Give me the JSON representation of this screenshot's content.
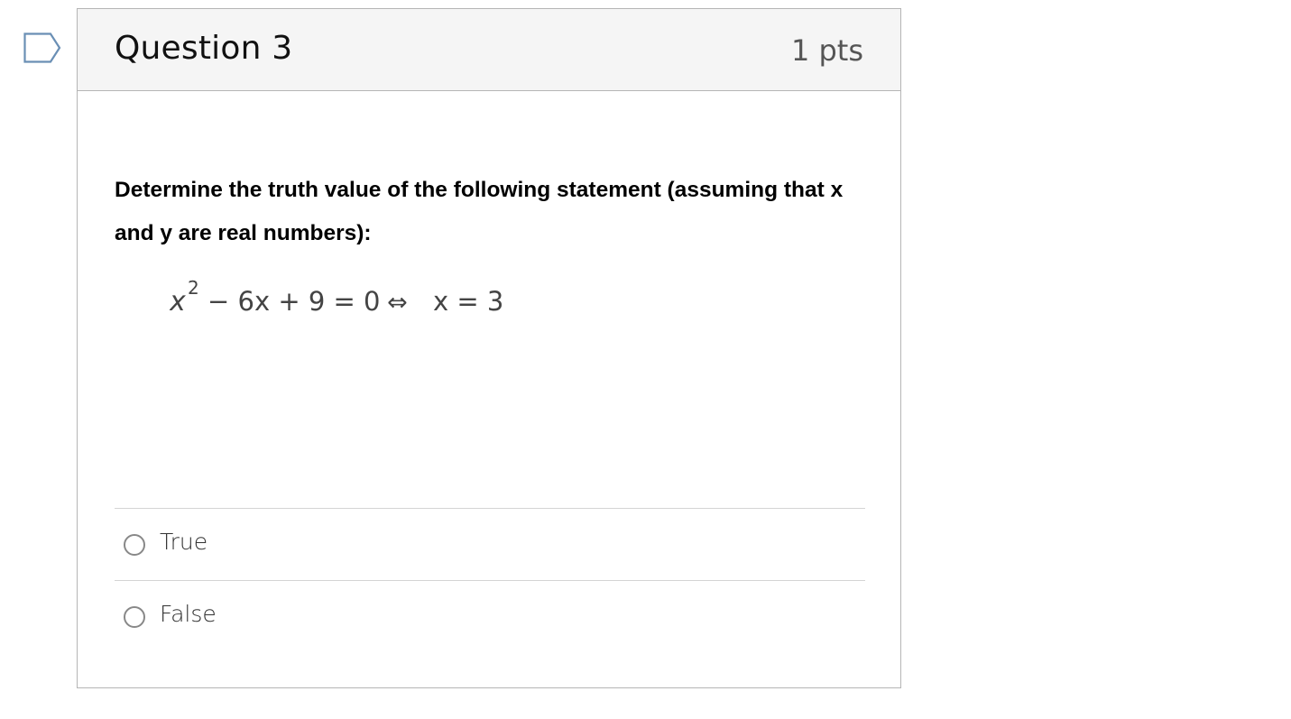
{
  "question": {
    "title": "Question 3",
    "points": "1 pts",
    "prompt": "Determine the truth value of the following statement (assuming that x and y are real numbers):",
    "equation": {
      "lhs_base": "x",
      "lhs_exp": "2",
      "lhs_rest": "− 6x + 9 = 0",
      "connective": "⇔",
      "rhs": "x = 3"
    }
  },
  "answers": [
    {
      "label": "True",
      "selected": false
    },
    {
      "label": "False",
      "selected": false
    }
  ],
  "icons": {
    "flag": "bookmark-flag-icon"
  },
  "colors": {
    "header_bg": "#f5f5f5",
    "border": "#b5b5b5",
    "flag_stroke": "#6a8fb5"
  }
}
